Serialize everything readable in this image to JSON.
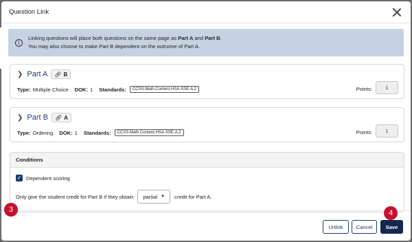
{
  "modal": {
    "title": "Question Link"
  },
  "info": {
    "line1_pre": "Linking questions will place both questions on the same page as ",
    "part_a": "Part A",
    "and": " and ",
    "part_b": "Part B",
    "period": ".",
    "line2": "You may also choose to make Part B dependent on the outcome of Part A."
  },
  "parts": [
    {
      "title": "Part A",
      "link_target": "B",
      "type_label": "Type:",
      "type_value": "Multiple Choice",
      "dok_label": "DOK:",
      "dok_value": "1",
      "standards_label": "Standards:",
      "standard": "CCSS.Math.Content.HSA-SSE.A.2",
      "points_label": "Points:",
      "points_value": "1"
    },
    {
      "title": "Part B",
      "link_target": "A",
      "type_label": "Type:",
      "type_value": "Ordering",
      "dok_label": "DOK:",
      "dok_value": "1",
      "standards_label": "Standards:",
      "standard": "CCSS.Math.Content.HSA-SSE.A.2",
      "points_label": "Points:",
      "points_value": "1"
    }
  ],
  "conditions": {
    "title": "Conditions",
    "dependent_scoring_label": "Dependent scoring",
    "dependent_scoring_checked": true,
    "sentence_pre": "Only give the student credit for Part B if they obtain",
    "credit_option": "partial",
    "sentence_post": "credit for Part A."
  },
  "footer": {
    "unlink": "Unlink",
    "cancel": "Cancel",
    "save": "Save"
  },
  "badges": {
    "step3": "3",
    "step4": "4"
  },
  "colors": {
    "accent": "#1d3a6b",
    "banner": "#c6d1e2",
    "badge": "#c8102e"
  },
  "icons": {
    "info": "info-icon",
    "close": "close-icon",
    "chevron": "chevron-right-icon",
    "link": "link-icon",
    "check": "check-icon",
    "caret": "caret-down-icon"
  }
}
